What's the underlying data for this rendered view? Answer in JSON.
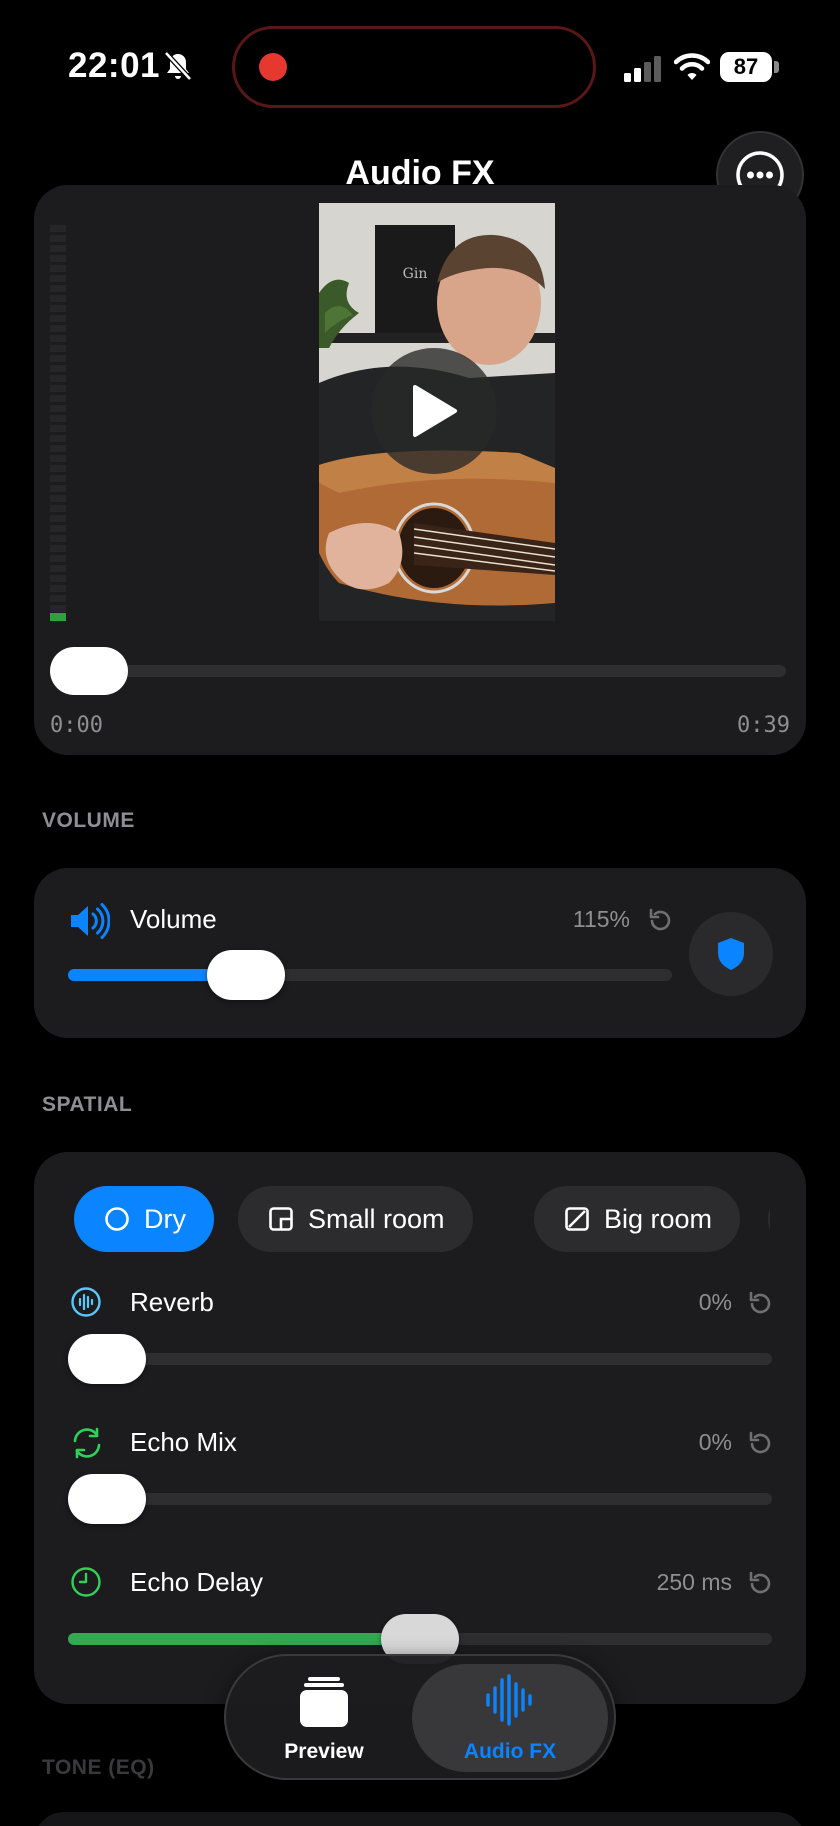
{
  "status_bar": {
    "time": "22:01",
    "battery": "87"
  },
  "header": {
    "title": "Audio FX"
  },
  "player": {
    "current_time": "0:00",
    "duration": "0:39",
    "progress": 0
  },
  "volume_section": {
    "header": "VOLUME",
    "label": "Volume",
    "value": "115%",
    "level": 0.265,
    "accent": "#0a84ff"
  },
  "spatial_section": {
    "header": "SPATIAL",
    "chips": [
      {
        "label": "Dry",
        "icon": "circle-icon",
        "active": true
      },
      {
        "label": "Small room",
        "icon": "small-room-icon",
        "active": false
      },
      {
        "label": "Big room",
        "icon": "big-room-icon",
        "active": false
      }
    ],
    "reverb": {
      "label": "Reverb",
      "value": "0%",
      "level": 0,
      "icon": "waveform-circle-icon",
      "color": "#5ac8fa"
    },
    "echo_mix": {
      "label": "Echo Mix",
      "value": "0%",
      "level": 0,
      "icon": "cycle-arrows-icon",
      "color": "#30d158"
    },
    "echo_delay": {
      "label": "Echo Delay",
      "value": "250 ms",
      "level": 0.5,
      "icon": "clock-icon",
      "color": "#30d158"
    }
  },
  "tone_section": {
    "header": "TONE (EQ)"
  },
  "tab_bar": {
    "tabs": [
      {
        "label": "Preview",
        "icon": "stack-icon",
        "active": false
      },
      {
        "label": "Audio FX",
        "icon": "waveform-icon",
        "active": true,
        "color": "#0a84ff"
      }
    ]
  }
}
